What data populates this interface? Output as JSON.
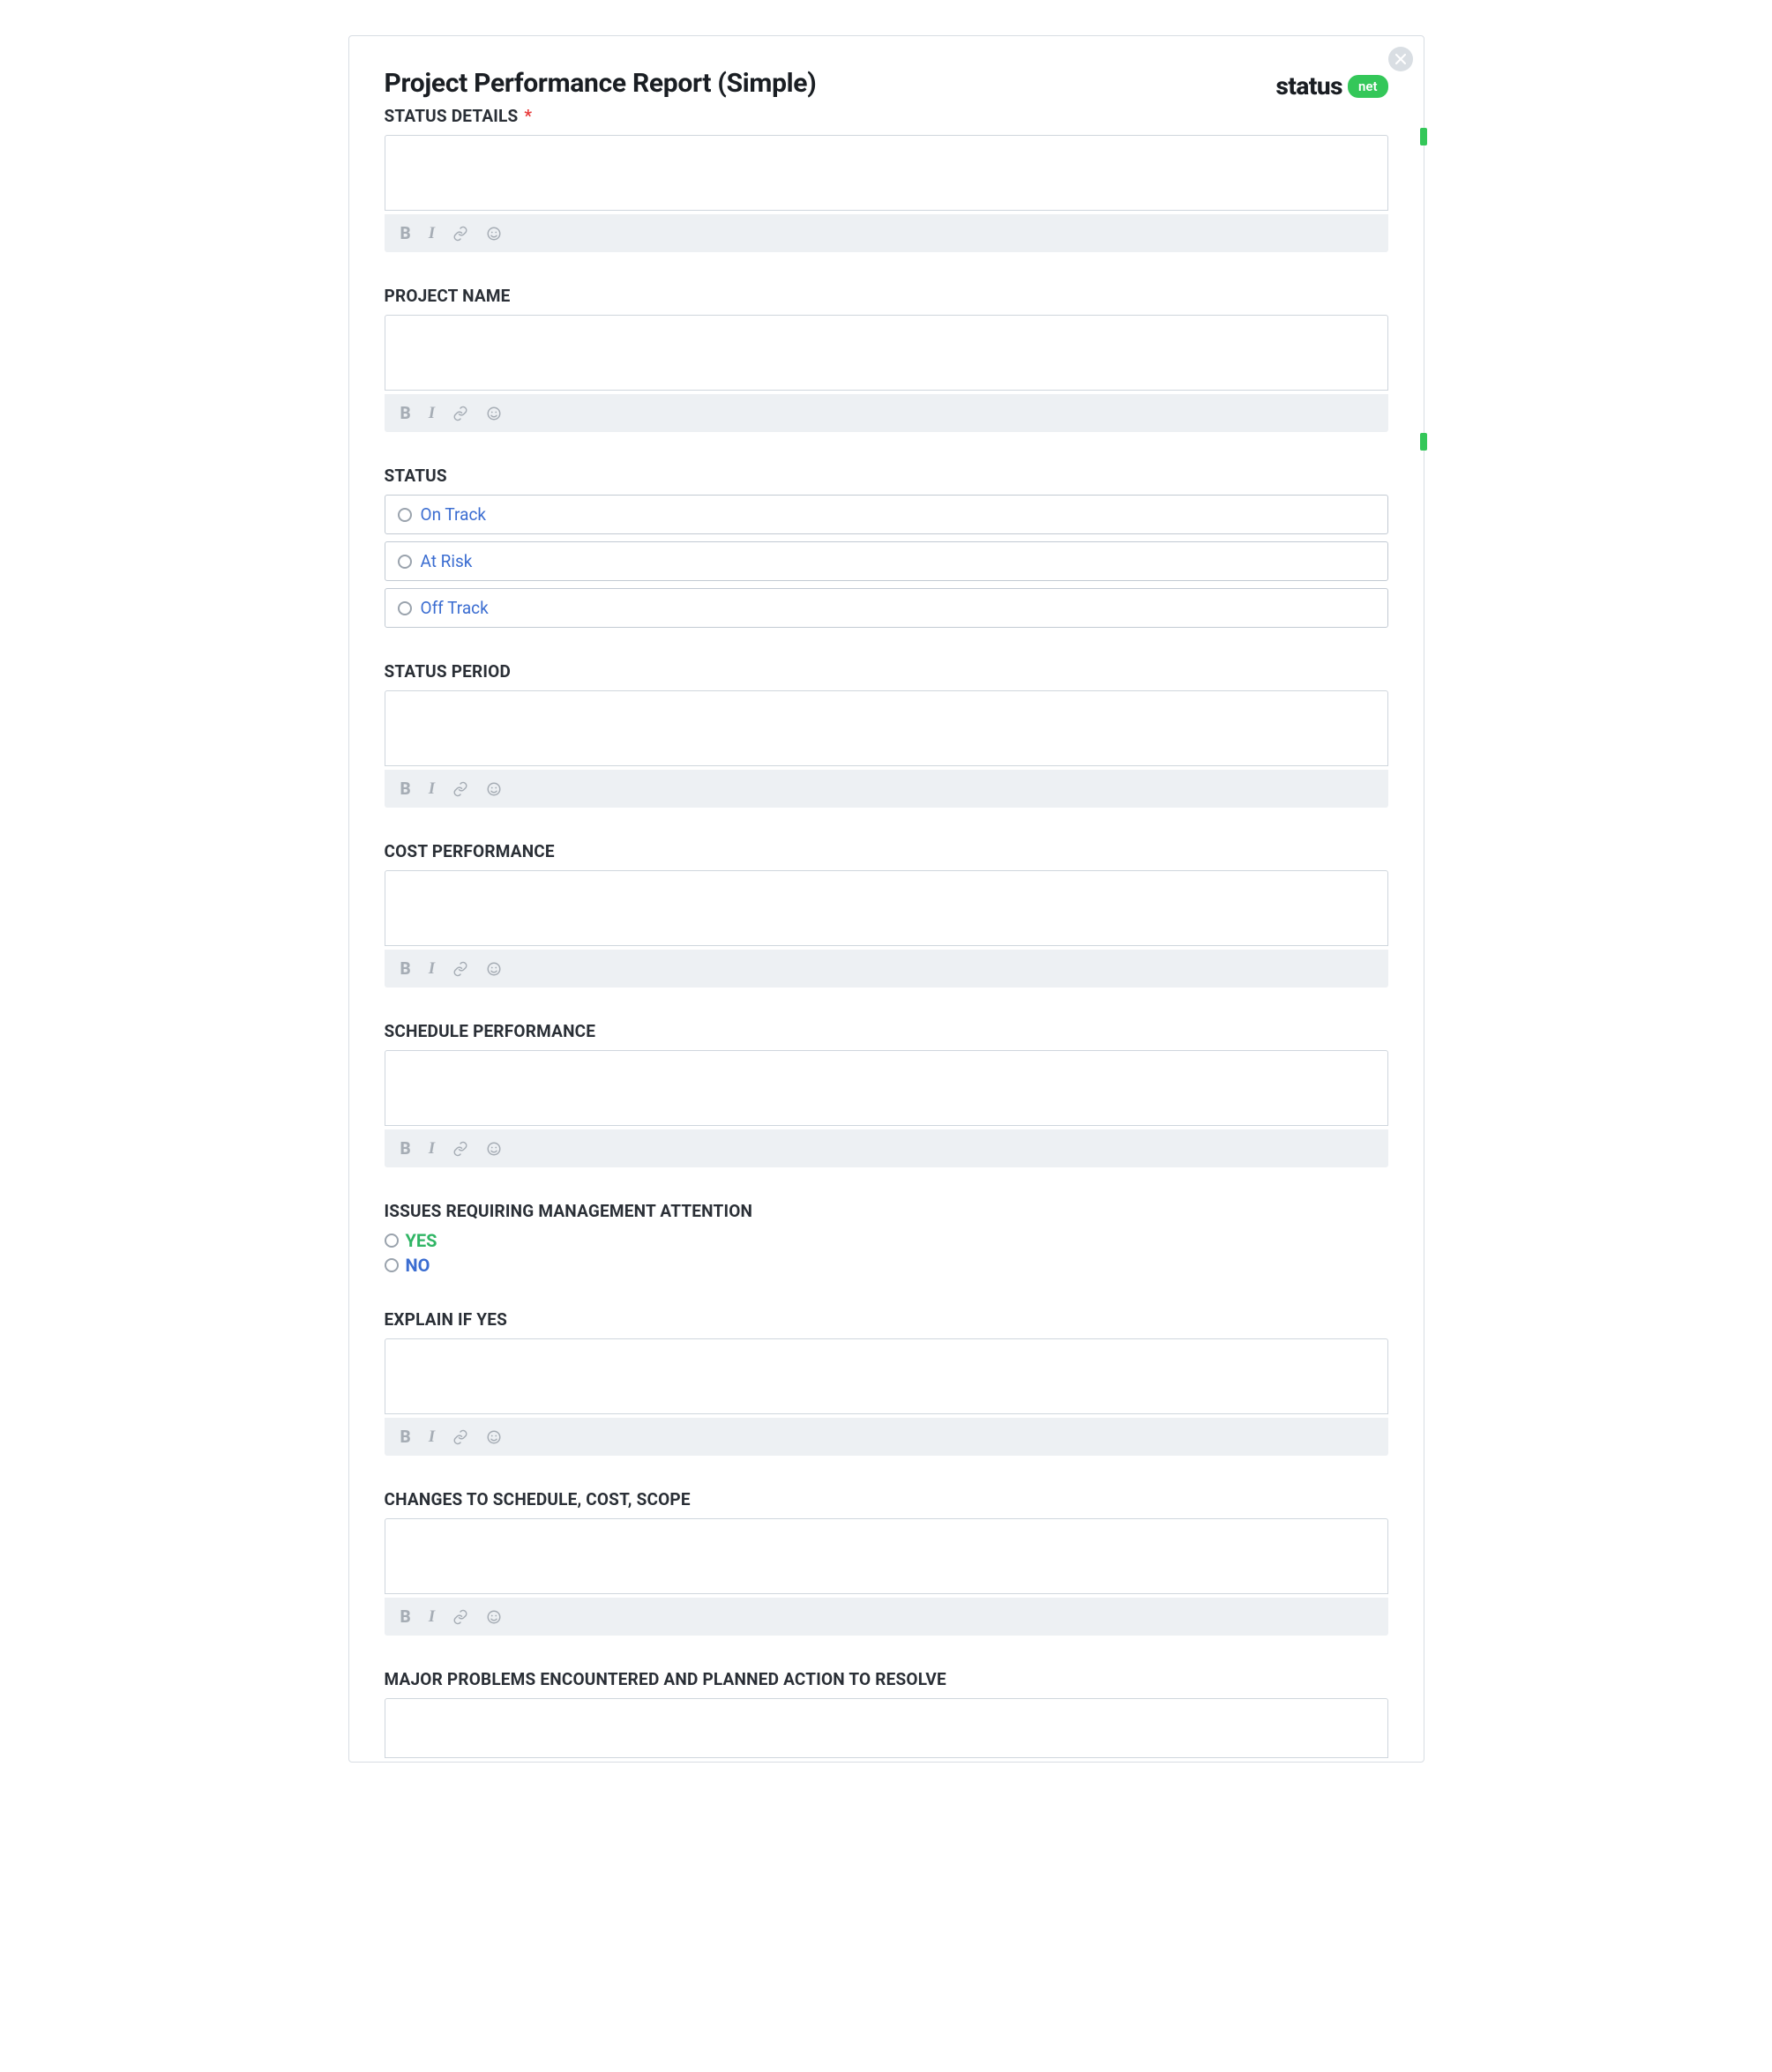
{
  "header": {
    "title": "Project Performance Report (Simple)",
    "brand_status": "status",
    "brand_net": "net"
  },
  "sections": {
    "status_details": {
      "label": "STATUS DETAILS",
      "required": "*"
    },
    "project_name": {
      "label": "PROJECT NAME"
    },
    "status": {
      "label": "STATUS",
      "options": {
        "on_track": "On Track",
        "at_risk": "At Risk",
        "off_track": "Off Track"
      }
    },
    "status_period": {
      "label": "STATUS PERIOD"
    },
    "cost_perf": {
      "label": "COST PERFORMANCE"
    },
    "schedule_perf": {
      "label": "SCHEDULE PERFORMANCE"
    },
    "issues": {
      "label": "ISSUES REQUIRING MANAGEMENT ATTENTION",
      "yes": "YES",
      "no": "NO"
    },
    "explain": {
      "label": "EXPLAIN IF YES"
    },
    "changes": {
      "label": "CHANGES TO SCHEDULE, COST, SCOPE"
    },
    "major_problems": {
      "label": "MAJOR PROBLEMS ENCOUNTERED AND PLANNED ACTION TO RESOLVE"
    }
  },
  "toolbar": {
    "bold": "B",
    "italic": "I"
  }
}
